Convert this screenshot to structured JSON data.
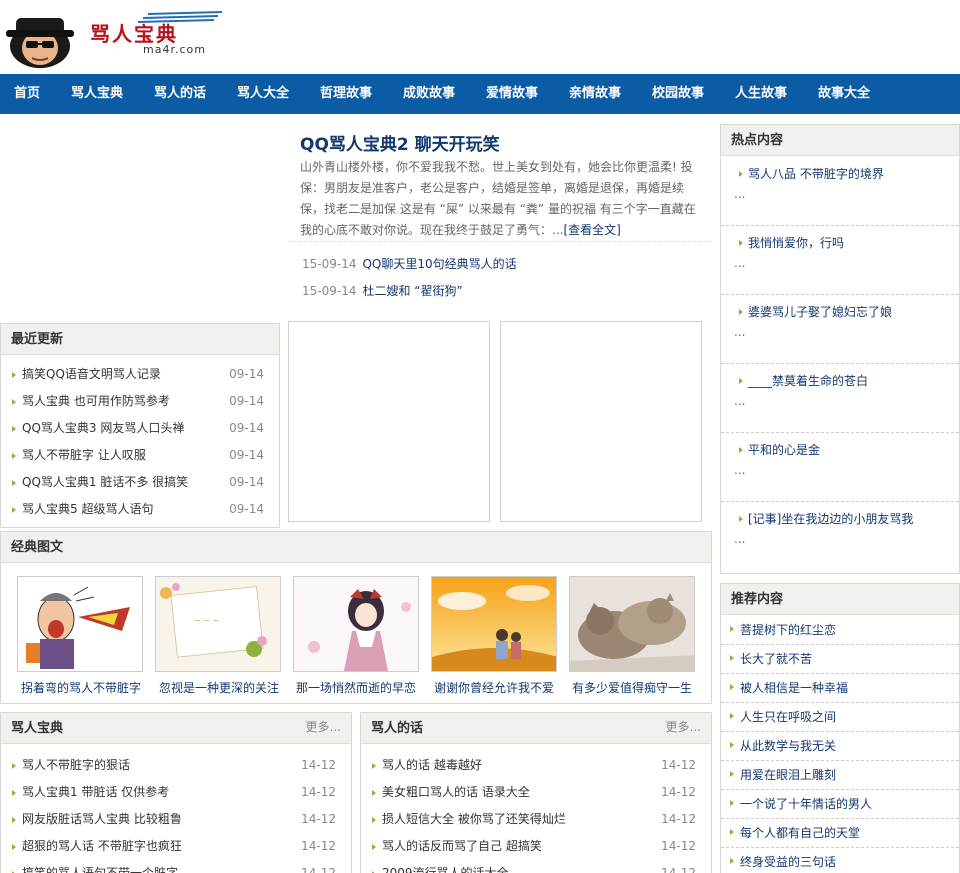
{
  "logo": {
    "title": "骂人宝典",
    "domain": "ma4r.com"
  },
  "nav": [
    "首页",
    "骂人宝典",
    "骂人的话",
    "骂人大全",
    "哲理故事",
    "成败故事",
    "爱情故事",
    "亲情故事",
    "校园故事",
    "人生故事",
    "故事大全"
  ],
  "featured": {
    "title": "QQ骂人宝典2 聊天开玩笑",
    "summary": "山外青山楼外楼，你不爱我我不愁。世上美女到处有，她会比你更温柔! 投保：男朋友是准客户，老公是客户，结婚是签单，离婚是退保，再婚是续保，找老二是加保  这是有 “屎” 以来最有 “粪” 量的祝福 有三个字一直藏在我的心底不敢对你说。现在我终于鼓足了勇气：...",
    "more": "[查看全文]",
    "links": [
      {
        "date": "15-09-14",
        "title": "QQ聊天里10句经典骂人的话"
      },
      {
        "date": "15-09-14",
        "title": "杜二嫂和 “翟街狗”"
      }
    ]
  },
  "recent": {
    "title": "最近更新",
    "items": [
      {
        "title": "搞笑QQ语音文明骂人记录",
        "date": "09-14"
      },
      {
        "title": "骂人宝典  也可用作防骂参考",
        "date": "09-14"
      },
      {
        "title": "QQ骂人宝典3 网友骂人口头禅",
        "date": "09-14"
      },
      {
        "title": "骂人不带脏字  让人叹服",
        "date": "09-14"
      },
      {
        "title": "QQ骂人宝典1 脏话不多  很搞笑",
        "date": "09-14"
      },
      {
        "title": "骂人宝典5 超级骂人语句",
        "date": "09-14"
      }
    ]
  },
  "hot": {
    "title": "热点内容",
    "items": [
      {
        "title": "骂人八品  不带脏字的境界",
        "dots": "..."
      },
      {
        "title": "我悄悄爱你，行吗",
        "dots": "..."
      },
      {
        "title": "婆婆骂儿子娶了媳妇忘了娘",
        "dots": "..."
      },
      {
        "title": "____禁莫着生命的苍白",
        "dots": "..."
      },
      {
        "title": "平和的心是金",
        "dots": "..."
      },
      {
        "title": "[记事]坐在我边边的小朋友骂我",
        "dots": "..."
      }
    ]
  },
  "gallery": {
    "title": "经典图文",
    "items": [
      {
        "caption": "拐着弯的骂人不带脏字"
      },
      {
        "caption": "忽视是一种更深的关注"
      },
      {
        "caption": "那一场悄然而逝的早恋"
      },
      {
        "caption": "谢谢你曾经允许我不爱"
      },
      {
        "caption": "有多少爱值得痴守一生"
      }
    ]
  },
  "recommend": {
    "title": "推荐内容",
    "items": [
      "菩提树下的红尘恋",
      "长大了就不苦",
      "被人相信是一种幸福",
      "人生只在呼吸之间",
      "从此数学与我无关",
      "用爱在眼泪上雕刻",
      "一个说了十年情话的男人",
      "每个人都有自己的天堂",
      "终身受益的三句话"
    ]
  },
  "col_left": {
    "title": "骂人宝典",
    "more": "更多...",
    "items": [
      {
        "title": "骂人不带脏字的狠话",
        "date": "14-12"
      },
      {
        "title": "骂人宝典1 带脏话  仅供参考",
        "date": "14-12"
      },
      {
        "title": "网友版脏话骂人宝典  比较粗鲁",
        "date": "14-12"
      },
      {
        "title": "超狠的骂人话  不带脏字也疯狂",
        "date": "14-12"
      },
      {
        "title": "搞笑的骂人语句不带一个脏字",
        "date": "14-12"
      }
    ]
  },
  "col_right": {
    "title": "骂人的话",
    "more": "更多...",
    "items": [
      {
        "title": "骂人的话  越毒越好",
        "date": "14-12"
      },
      {
        "title": "美女粗口骂人的话  语录大全",
        "date": "14-12"
      },
      {
        "title": "损人短信大全  被你骂了还笑得灿烂",
        "date": "14-12"
      },
      {
        "title": "骂人的话反而骂了自己  超搞笑",
        "date": "14-12"
      },
      {
        "title": "2009流行骂人的话大全",
        "date": "14-12"
      }
    ]
  }
}
